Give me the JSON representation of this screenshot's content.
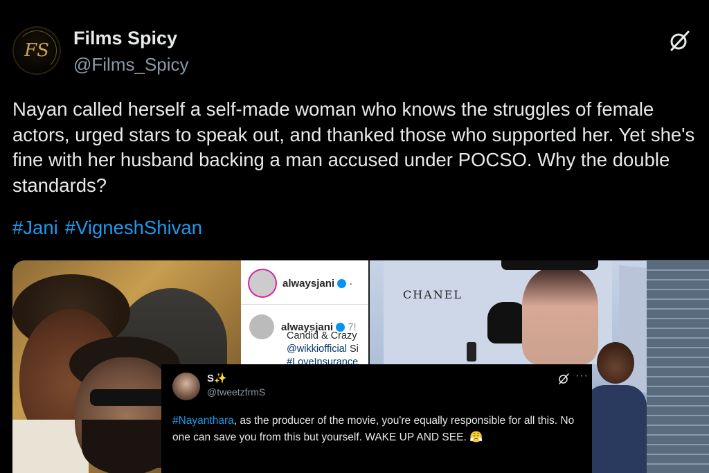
{
  "tweet": {
    "display_name": "Films Spicy",
    "handle": "@Films_Spicy",
    "avatar_monogram": "FS",
    "text": "Nayan called herself a self-made woman who knows the struggles of female actors, urged stars to speak out, and thanked those who supported her. Yet she's fine with her husband backing a man accused under POCSO. Why the double standards?",
    "hashtags": [
      "#Jani",
      "#VigneshShivan"
    ],
    "grok_icon": "grok-slash-icon"
  },
  "media": {
    "instagram": {
      "username": "alwaysjani",
      "separator": "·",
      "time_partial": "7!",
      "caption_line1": "Candid & Crazy",
      "caption_mention": "@wikkiofficial",
      "caption_mention_tail": " Si",
      "caption_line3": "#LoveInsurance"
    },
    "billboard_brand": "CHANEL"
  },
  "reply": {
    "display_name": "S✨",
    "handle": "@tweetzfrmS",
    "hashtag": "#Nayanthara",
    "text": ", as the producer of the movie, you're equally responsible for all this. No one can save you from this but yourself. WAKE UP AND SEE. 😤",
    "more": "···"
  },
  "colors": {
    "accent": "#1d9bf0",
    "background": "#000000",
    "secondary_text": "#8b98a5"
  }
}
